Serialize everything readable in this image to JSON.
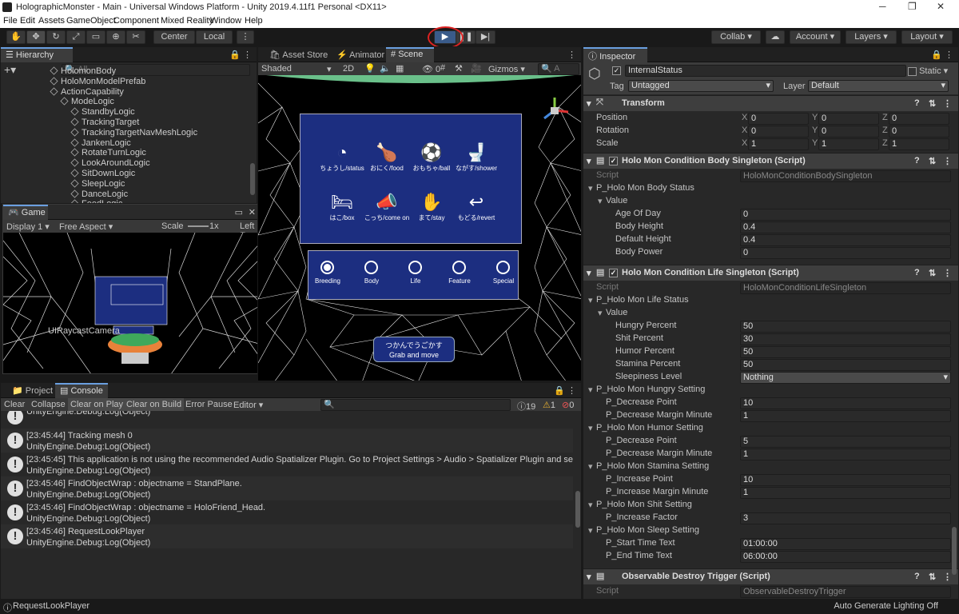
{
  "window": {
    "title": "HolographicMonster - Main - Universal Windows Platform - Unity 2019.4.11f1 Personal <DX11>"
  },
  "menu": [
    "File",
    "Edit",
    "Assets",
    "GameObject",
    "Component",
    "Mixed Reality",
    "Window",
    "Help"
  ],
  "toolbar": {
    "center_label": "Center",
    "local_label": "Local",
    "collab_label": "Collab",
    "account_label": "Account",
    "layers_label": "Layers",
    "layout_label": "Layout"
  },
  "hierarchy": {
    "title": "Hierarchy",
    "search_placeholder": "All",
    "items": [
      {
        "label": "HolomonBody",
        "indent": 4
      },
      {
        "label": "HoloMonModelPrefab",
        "indent": 4
      },
      {
        "label": "ActionCapability",
        "indent": 4
      },
      {
        "label": "ModeLogic",
        "indent": 5
      },
      {
        "label": "StandbyLogic",
        "indent": 6
      },
      {
        "label": "TrackingTarget",
        "indent": 6
      },
      {
        "label": "TrackingTargetNavMeshLogic",
        "indent": 6
      },
      {
        "label": "JankenLogic",
        "indent": 6
      },
      {
        "label": "RotateTurnLogic",
        "indent": 6
      },
      {
        "label": "LookAroundLogic",
        "indent": 6
      },
      {
        "label": "SitDownLogic",
        "indent": 6
      },
      {
        "label": "SleepLogic",
        "indent": 6
      },
      {
        "label": "DanceLogic",
        "indent": 6
      },
      {
        "label": "FeedLogic",
        "indent": 6
      }
    ],
    "uiraycast": "UIRaycastCamera"
  },
  "game": {
    "tab": "Game",
    "display": "Display 1",
    "aspect": "Free Aspect",
    "scale_label": "Scale",
    "scale_value": "1x",
    "left_label": "Left E"
  },
  "scene": {
    "tabs": [
      "Asset Store",
      "Animator",
      "Scene"
    ],
    "shading": "Shaded",
    "mode_2d": "2D",
    "gizmos": "Gizmos",
    "search_placeholder": "A",
    "hidden_count": "0",
    "menu_buttons": [
      {
        "icon": "gauge-icon",
        "glyph": "◔",
        "label": "ちょうし/status"
      },
      {
        "icon": "drumstick-icon",
        "glyph": "🍗",
        "label": "おにく/food"
      },
      {
        "icon": "ball-icon",
        "glyph": "⚽",
        "label": "おもちゃ/ball"
      },
      {
        "icon": "toilet-icon",
        "glyph": "🚽",
        "label": "ながす/shower"
      },
      {
        "icon": "bed-icon",
        "glyph": "🛏",
        "label": "はこ/box"
      },
      {
        "icon": "megaphone-icon",
        "glyph": "📣",
        "label": "こっち/come on"
      },
      {
        "icon": "hand-icon",
        "glyph": "✋",
        "label": "まて/stay"
      },
      {
        "icon": "undo-icon",
        "glyph": "↩",
        "label": "もどる/revert"
      }
    ],
    "radio_tabs": [
      {
        "label": "Breeding",
        "selected": true
      },
      {
        "label": "Body",
        "selected": false
      },
      {
        "label": "Life",
        "selected": false
      },
      {
        "label": "Feature",
        "selected": false
      },
      {
        "label": "Special",
        "selected": false
      }
    ],
    "grab_jp": "つかんでうごかす",
    "grab_en": "Grab and move"
  },
  "console": {
    "tabs": [
      "Project",
      "Console"
    ],
    "buttons": [
      "Clear",
      "Collapse",
      "Clear on Play",
      "Clear on Build",
      "Error Pause",
      "Editor"
    ],
    "counts": {
      "info": "19",
      "warn": "1",
      "error": "0"
    },
    "messages": [
      {
        "l1": "UnityEngine.Debug:Log(Object)",
        "l2": ""
      },
      {
        "l1": "[23:45:44] Tracking mesh 0",
        "l2": "UnityEngine.Debug:Log(Object)"
      },
      {
        "l1": "[23:45:45] This application is not using the recommended Audio Spatializer Plugin. Go to Project Settings > Audio > Spatializer Plugin and select or",
        "l2": "UnityEngine.Debug:Log(Object)"
      },
      {
        "l1": "[23:45:46] FindObjectWrap : objectname = StandPlane.",
        "l2": "UnityEngine.Debug:Log(Object)"
      },
      {
        "l1": "[23:45:46] FindObjectWrap : objectname = HoloFriend_Head.",
        "l2": "UnityEngine.Debug:Log(Object)"
      },
      {
        "l1": "[23:45:46] RequestLookPlayer",
        "l2": "UnityEngine.Debug:Log(Object)"
      }
    ]
  },
  "inspector": {
    "title": "Inspector",
    "object_name": "InternalStatus",
    "static_label": "Static",
    "tag_label": "Tag",
    "tag_value": "Untagged",
    "layer_label": "Layer",
    "layer_value": "Default",
    "transform": {
      "title": "Transform",
      "rows": [
        {
          "label": "Position",
          "x": "0",
          "y": "0",
          "z": "0"
        },
        {
          "label": "Rotation",
          "x": "0",
          "y": "0",
          "z": "0"
        },
        {
          "label": "Scale",
          "x": "1",
          "y": "1",
          "z": "1"
        }
      ]
    },
    "comp1": {
      "title": "Holo Mon Condition Body Singleton (Script)",
      "script_label": "Script",
      "script_value": "HoloMonConditionBodySingleton",
      "group": "P_Holo Mon Body Status",
      "value_label": "Value",
      "fields": [
        {
          "label": "Age Of Day",
          "value": "0"
        },
        {
          "label": "Body Height",
          "value": "0.4"
        },
        {
          "label": "Default Height",
          "value": "0.4"
        },
        {
          "label": "Body Power",
          "value": "0"
        }
      ]
    },
    "comp2": {
      "title": "Holo Mon Condition Life Singleton (Script)",
      "script_label": "Script",
      "script_value": "HoloMonConditionLifeSingleton",
      "group": "P_Holo Mon Life Status",
      "value_label": "Value",
      "fields": [
        {
          "label": "Hungry Percent",
          "value": "50"
        },
        {
          "label": "Shit Percent",
          "value": "30"
        },
        {
          "label": "Humor Percent",
          "value": "50"
        },
        {
          "label": "Stamina Percent",
          "value": "50"
        },
        {
          "label": "Sleepiness Level",
          "value": "Nothing"
        }
      ],
      "settings": [
        {
          "title": "P_Holo Mon Hungry Setting",
          "fields": [
            {
              "label": "P_Decrease Point",
              "value": "10"
            },
            {
              "label": "P_Decrease Margin Minute",
              "value": "1"
            }
          ]
        },
        {
          "title": "P_Holo Mon Humor Setting",
          "fields": [
            {
              "label": "P_Decrease Point",
              "value": "5"
            },
            {
              "label": "P_Decrease Margin Minute",
              "value": "1"
            }
          ]
        },
        {
          "title": "P_Holo Mon Stamina Setting",
          "fields": [
            {
              "label": "P_Increase Point",
              "value": "10"
            },
            {
              "label": "P_Increase Margin Minute",
              "value": "1"
            }
          ]
        },
        {
          "title": "P_Holo Mon Shit Setting",
          "fields": [
            {
              "label": "P_Increase Factor",
              "value": "3"
            }
          ]
        },
        {
          "title": "P_Holo Mon Sleep Setting",
          "fields": [
            {
              "label": "P_Start Time Text",
              "value": "01:00:00"
            },
            {
              "label": "P_End Time Text",
              "value": "06:00:00"
            }
          ]
        }
      ]
    },
    "comp3": {
      "title": "Observable Destroy Trigger (Script)",
      "script_label": "Script",
      "script_value": "ObservableDestroyTrigger"
    }
  },
  "status": {
    "left": "RequestLookPlayer",
    "right": "Auto Generate Lighting Off"
  }
}
